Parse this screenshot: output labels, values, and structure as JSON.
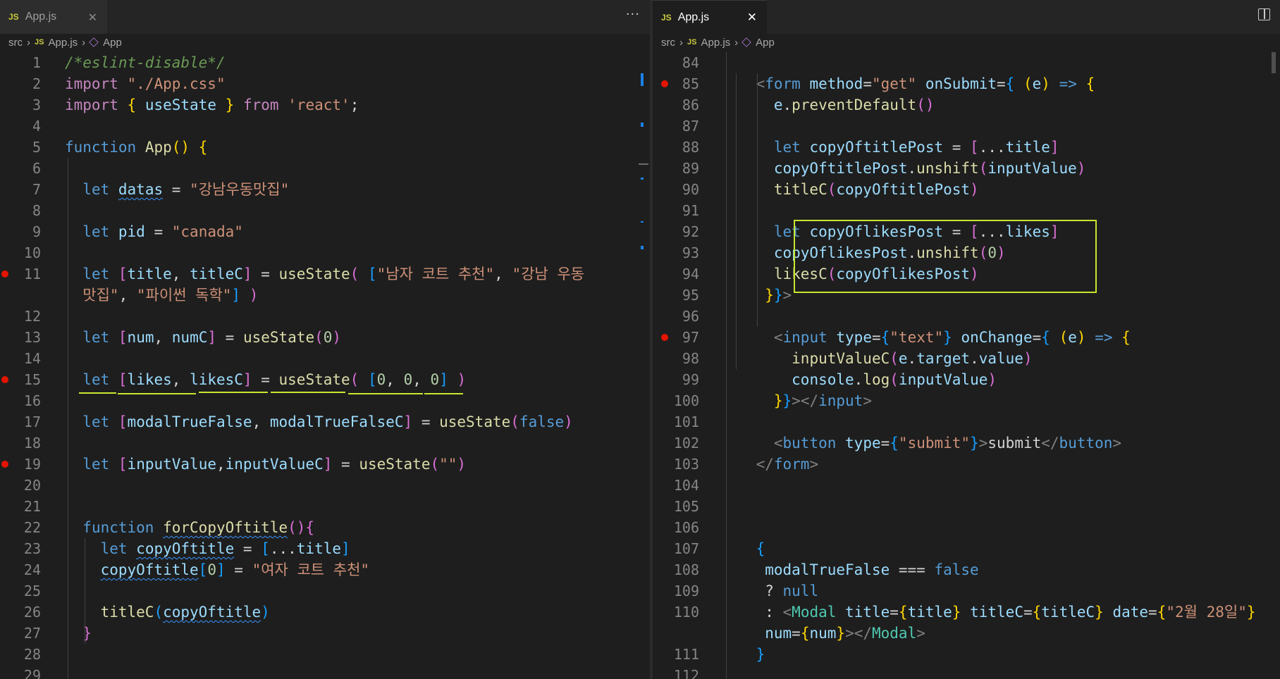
{
  "left": {
    "tab": {
      "badge": "JS",
      "name": "App.js",
      "close": "✕"
    },
    "more": "···",
    "breadcrumb": {
      "folder": "src",
      "file_badge": "JS",
      "file": "App.js",
      "symbol": "App"
    },
    "lines": [
      {
        "n": "1",
        "html": "<span class='com'>/*eslint-disable*/</span>"
      },
      {
        "n": "2",
        "html": "<span class='kw2'>import</span> <span class='str'>\"./App.css\"</span>"
      },
      {
        "n": "3",
        "html": "<span class='kw2'>import</span> <span class='br1'>{</span> <span class='var'>useState</span> <span class='br1'>}</span> <span class='kw2'>from</span> <span class='str'>'react'</span>;"
      },
      {
        "n": "4",
        "html": ""
      },
      {
        "n": "5",
        "html": "<span class='kw'>function</span> <span class='fn'>App</span><span class='br1'>()</span> <span class='br1'>{</span>"
      },
      {
        "n": "6",
        "html": ""
      },
      {
        "n": "7",
        "html": "  <span class='kw'>let</span> <span class='var squig'>datas</span> = <span class='str'>\"강남우동맛집\"</span>"
      },
      {
        "n": "8",
        "html": ""
      },
      {
        "n": "9",
        "html": "  <span class='kw'>let</span> <span class='var'>pid</span> = <span class='str'>\"canada\"</span>"
      },
      {
        "n": "10",
        "html": ""
      },
      {
        "n": "11",
        "html": "  <span class='kw'>let</span> <span class='br2'>[</span><span class='var'>title</span>, <span class='var'>titleC</span><span class='br2'>]</span> = <span class='fn'>useState</span><span class='br2'>(</span> <span class='br3'>[</span><span class='str'>\"남자 코트 추천\"</span>, <span class='str'>\"강남 우동</span>",
        "bp": true
      },
      {
        "n": "",
        "html": "  <span class='str'>맛집\"</span>, <span class='str'>\"파이썬 독학\"</span><span class='br3'>]</span> <span class='br2'>)</span>"
      },
      {
        "n": "12",
        "html": ""
      },
      {
        "n": "13",
        "html": "  <span class='kw'>let</span> <span class='br2'>[</span><span class='var'>num</span>, <span class='var'>numC</span><span class='br2'>]</span> = <span class='fn'>useState</span><span class='br2'>(</span><span class='num'>0</span><span class='br2'>)</span>"
      },
      {
        "n": "14",
        "html": ""
      },
      {
        "n": "15",
        "html": "  <span class='kw'>let</span> <span class='br2'>[</span><span class='var'>likes</span>, <span class='var'>likesC</span><span class='br2'>]</span> = <span class='fn'>useState</span><span class='br2'>(</span> <span class='br3'>[</span><span class='num'>0</span>, <span class='num'>0</span>, <span class='num'>0</span><span class='br3'>]</span> <span class='br2'>)</span>",
        "bp": true
      },
      {
        "n": "16",
        "html": ""
      },
      {
        "n": "17",
        "html": "  <span class='kw'>let</span> <span class='br2'>[</span><span class='var'>modalTrueFalse</span>, <span class='var'>modalTrueFalseC</span><span class='br2'>]</span> = <span class='fn'>useState</span><span class='br2'>(</span><span class='kw'>false</span><span class='br2'>)</span>"
      },
      {
        "n": "18",
        "html": ""
      },
      {
        "n": "19",
        "html": "  <span class='kw'>let</span> <span class='br2'>[</span><span class='var'>inputValue</span>,<span class='var'>inputValueC</span><span class='br2'>]</span> = <span class='fn'>useState</span><span class='br2'>(</span><span class='str'>\"\"</span><span class='br2'>)</span>",
        "bp": true
      },
      {
        "n": "20",
        "html": ""
      },
      {
        "n": "21",
        "html": ""
      },
      {
        "n": "22",
        "html": "  <span class='kw'>function</span> <span class='fn squig'>forCopyOftitle</span><span class='br2'>()</span><span class='br2'>{</span>"
      },
      {
        "n": "23",
        "html": "    <span class='kw'>let</span> <span class='var squig'>copyOftitle</span> = <span class='br3'>[</span>...<span class='var'>title</span><span class='br3'>]</span>"
      },
      {
        "n": "24",
        "html": "    <span class='var squig'>copyOftitle</span><span class='br3'>[</span><span class='num'>0</span><span class='br3'>]</span> = <span class='str'>\"여자 코트 추천\"</span>"
      },
      {
        "n": "25",
        "html": ""
      },
      {
        "n": "26",
        "html": "    <span class='fn'>titleC</span><span class='br3'>(</span><span class='var squig'>copyOftitle</span><span class='br3'>)</span>"
      },
      {
        "n": "27",
        "html": "  <span class='br2'>}</span>"
      },
      {
        "n": "28",
        "html": ""
      },
      {
        "n": "29",
        "html": ""
      }
    ]
  },
  "right": {
    "tab": {
      "badge": "JS",
      "name": "App.js",
      "close": "✕"
    },
    "breadcrumb": {
      "folder": "src",
      "file_badge": "JS",
      "file": "App.js",
      "symbol": "App"
    },
    "lines": [
      {
        "n": "84",
        "html": ""
      },
      {
        "n": "85",
        "html": "    <span class='pun'>&lt;</span><span class='tag'>form</span> <span class='var'>method</span>=<span class='str'>\"get\"</span> <span class='var'>onSubmit</span>=<span class='br3'>{</span> <span class='br1'>(</span><span class='var'>e</span><span class='br1'>)</span> <span class='kw'>=&gt;</span> <span class='br1'>{</span>",
        "bp": true
      },
      {
        "n": "86",
        "html": "      <span class='var'>e</span>.<span class='fn'>preventDefault</span><span class='br2'>()</span>"
      },
      {
        "n": "87",
        "html": ""
      },
      {
        "n": "88",
        "html": "      <span class='kw'>let</span> <span class='var'>copyOftitlePost</span> = <span class='br2'>[</span>...<span class='var'>title</span><span class='br2'>]</span>"
      },
      {
        "n": "89",
        "html": "      <span class='var'>copyOftitlePost</span>.<span class='fn'>unshift</span><span class='br2'>(</span><span class='var'>inputValue</span><span class='br2'>)</span>"
      },
      {
        "n": "90",
        "html": "      <span class='fn'>titleC</span><span class='br2'>(</span><span class='var'>copyOftitlePost</span><span class='br2'>)</span>"
      },
      {
        "n": "91",
        "html": ""
      },
      {
        "n": "92",
        "html": "      <span class='kw'>let</span> <span class='var'>copyOflikesPost</span> = <span class='br2'>[</span>...<span class='var'>likes</span><span class='br2'>]</span>"
      },
      {
        "n": "93",
        "html": "      <span class='var'>copyOflikesPost</span>.<span class='fn'>unshift</span><span class='br2'>(</span><span class='num'>0</span><span class='br2'>)</span>"
      },
      {
        "n": "94",
        "html": "      <span class='fn'>likesC</span><span class='br2'>(</span><span class='var'>copyOflikesPost</span><span class='br2'>)</span>"
      },
      {
        "n": "95",
        "html": "     <span class='br1'>}</span><span class='br3'>}</span><span class='pun'>&gt;</span>"
      },
      {
        "n": "96",
        "html": ""
      },
      {
        "n": "97",
        "html": "      <span class='pun'>&lt;</span><span class='tag'>input</span> <span class='var'>type</span>=<span class='br3'>{</span><span class='str'>\"text\"</span><span class='br3'>}</span> <span class='var'>onChange</span>=<span class='br3'>{</span> <span class='br1'>(</span><span class='var'>e</span><span class='br1'>)</span> <span class='kw'>=&gt;</span> <span class='br1'>{</span>",
        "bp": true
      },
      {
        "n": "98",
        "html": "        <span class='fn'>inputValueC</span><span class='br2'>(</span><span class='var'>e</span>.<span class='var'>target</span>.<span class='var'>value</span><span class='br2'>)</span>"
      },
      {
        "n": "99",
        "html": "        <span class='var'>console</span>.<span class='fn'>log</span><span class='br2'>(</span><span class='var'>inputValue</span><span class='br2'>)</span>"
      },
      {
        "n": "100",
        "html": "      <span class='br1'>}</span><span class='br3'>}</span><span class='pun'>&gt;&lt;/</span><span class='tag'>input</span><span class='pun'>&gt;</span>"
      },
      {
        "n": "101",
        "html": ""
      },
      {
        "n": "102",
        "html": "      <span class='pun'>&lt;</span><span class='tag'>button</span> <span class='var'>type</span>=<span class='br3'>{</span><span class='str'>\"submit\"</span><span class='br3'>}</span><span class='pun'>&gt;</span>submit<span class='pun'>&lt;/</span><span class='tag'>button</span><span class='pun'>&gt;</span>"
      },
      {
        "n": "103",
        "html": "    <span class='pun'>&lt;/</span><span class='tag'>form</span><span class='pun'>&gt;</span>"
      },
      {
        "n": "104",
        "html": ""
      },
      {
        "n": "105",
        "html": ""
      },
      {
        "n": "106",
        "html": ""
      },
      {
        "n": "107",
        "html": "    <span class='br3'>{</span>"
      },
      {
        "n": "108",
        "html": "     <span class='var'>modalTrueFalse</span> === <span class='kw'>false</span>"
      },
      {
        "n": "109",
        "html": "     ? <span class='kw'>null</span>"
      },
      {
        "n": "110",
        "html": "     : <span class='pun'>&lt;</span><span class='comp'>Modal</span> <span class='var'>title</span>=<span class='br1'>{</span><span class='var'>title</span><span class='br1'>}</span> <span class='var'>titleC</span>=<span class='br1'>{</span><span class='var'>titleC</span><span class='br1'>}</span> <span class='var'>date</span>=<span class='br1'>{</span><span class='str'>\"2월 28일\"</span><span class='br1'>}</span>"
      },
      {
        "n": "",
        "html": "     <span class='var'>num</span>=<span class='br1'>{</span><span class='var'>num</span><span class='br1'>}</span><span class='pun'>&gt;&lt;/</span><span class='comp'>Modal</span><span class='pun'>&gt;</span>"
      },
      {
        "n": "111",
        "html": "    <span class='br3'>}</span>"
      },
      {
        "n": "112",
        "html": ""
      }
    ]
  }
}
